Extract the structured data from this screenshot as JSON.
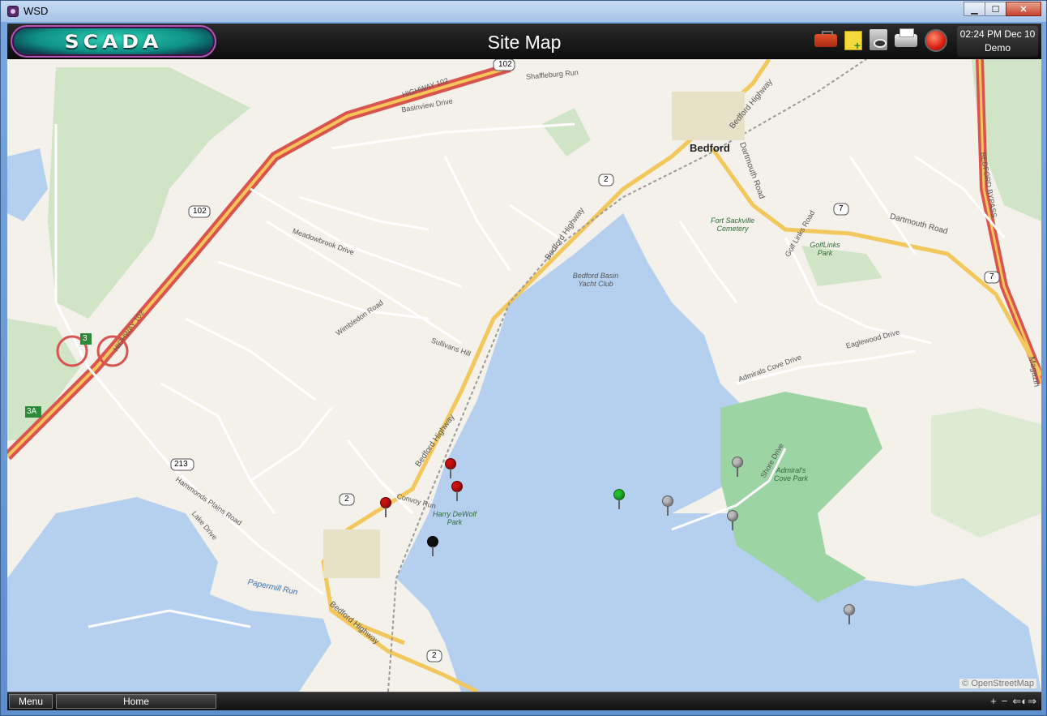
{
  "window": {
    "title": "WSD",
    "minimize": "▁",
    "maximize": "☐",
    "close": "✕"
  },
  "header": {
    "logo_text": "SCADA",
    "page_title": "Site Map",
    "clock_time": "02:24 PM Dec 10",
    "user": "Demo",
    "icons": [
      "toolbox-icon",
      "sticky-note-icon",
      "view-document-icon",
      "printer-icon",
      "alarm-bell-icon"
    ]
  },
  "map": {
    "attribution": "© OpenStreetMap",
    "labels": {
      "bedford": "Bedford",
      "highway102": "HIGHWAY 102",
      "bedford_highway": "Bedford Highway",
      "dartmouth_road": "Dartmouth Road",
      "bedford_bypass": "BEDFORD BYPASS",
      "yacht_club": "Bedford Basin Yacht Club",
      "fort_sackville": "Fort Sackville Cemetery",
      "golf_links_park": "GolfLinks Park",
      "admirals_cove_park": "Admiral's Cove Park",
      "harry_dewolf_park": "Harry DeWolf Park",
      "papermill_run": "Papermill Run",
      "hammonds_plains_road": "Hammonds Plains Road",
      "shore_drive": "Shore Drive",
      "admirals_cove_drive": "Admirals Cove Drive",
      "meadowbrook_drive": "Meadowbrook Drive",
      "basinview_drive": "Basinview Drive",
      "wimbledon_road": "Wimbledon Road",
      "sullivans_hill": "Sullivans Hill",
      "eaglewood_drive": "Eaglewood Drive",
      "golf_links_road": "Golf Links Road",
      "shaffleburg_run": "Shaffleburg Run",
      "convoy_run": "Convoy Run",
      "lake_drive": "Lake Drive",
      "magazine": "Magazin",
      "shield_102": "102",
      "shield_2": "2",
      "shield_7": "7",
      "shield_213": "213",
      "exit_3": "3",
      "exit_3a": "3A"
    },
    "pins": [
      {
        "name": "site-pin",
        "color": "#cc1111",
        "status": "alarm"
      },
      {
        "name": "site-pin",
        "color": "#cc1111",
        "status": "alarm"
      },
      {
        "name": "site-pin",
        "color": "#cc1111",
        "status": "alarm"
      },
      {
        "name": "site-pin",
        "color": "#111111",
        "status": "offline"
      },
      {
        "name": "site-pin",
        "color": "#22c22a",
        "status": "normal"
      },
      {
        "name": "site-pin",
        "color": "#bbbbbb",
        "status": "inactive"
      },
      {
        "name": "site-pin",
        "color": "#bbbbbb",
        "status": "inactive"
      },
      {
        "name": "site-pin",
        "color": "#bbbbbb",
        "status": "inactive"
      },
      {
        "name": "site-pin",
        "color": "#bbbbbb",
        "status": "inactive"
      }
    ]
  },
  "footer": {
    "menu": "Menu",
    "home": "Home",
    "zoom_in": "+",
    "zoom_out": "−",
    "pan": "⇐◐⇒"
  }
}
